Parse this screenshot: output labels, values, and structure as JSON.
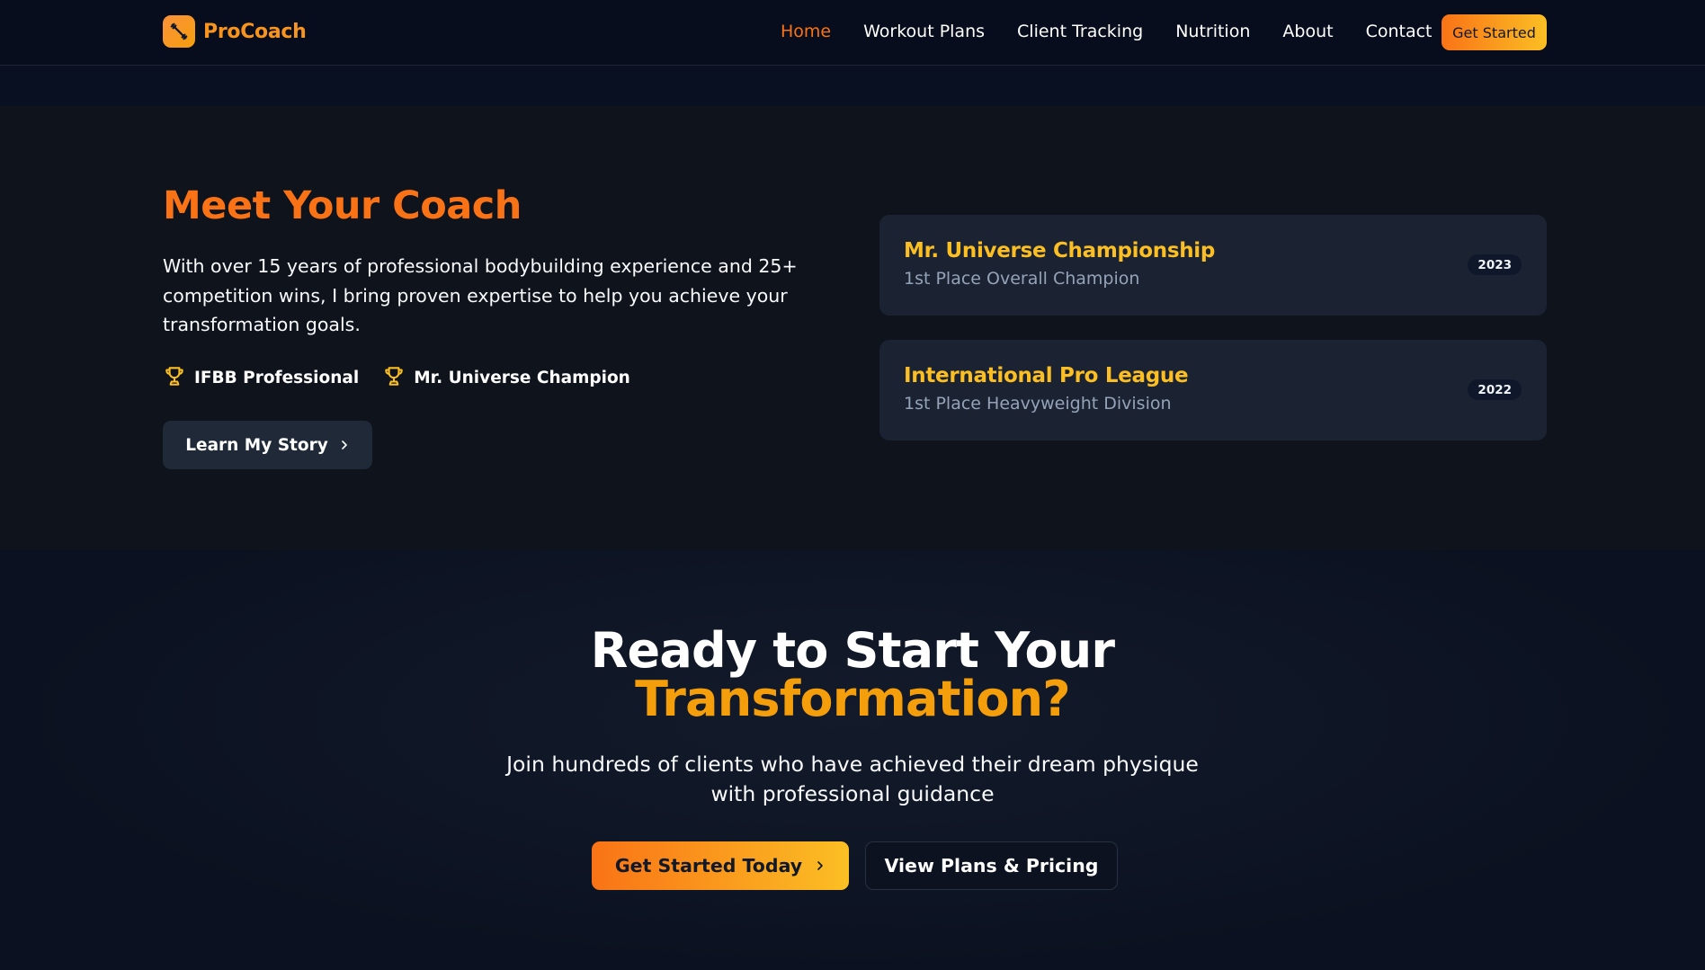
{
  "nav": {
    "brand": "ProCoach",
    "links": [
      {
        "label": "Home",
        "active": true
      },
      {
        "label": "Workout Plans",
        "active": false
      },
      {
        "label": "Client Tracking",
        "active": false
      },
      {
        "label": "Nutrition",
        "active": false
      },
      {
        "label": "About",
        "active": false
      },
      {
        "label": "Contact",
        "active": false
      }
    ],
    "cta_label": "Get Started"
  },
  "coach": {
    "title": "Meet Your Coach",
    "description": "With over 15 years of professional bodybuilding experience and 25+ competition wins, I bring proven expertise to help you achieve your transformation goals.",
    "badges": [
      {
        "icon": "trophy-icon",
        "label": "IFBB Professional"
      },
      {
        "icon": "trophy-icon",
        "label": "Mr. Universe Champion"
      }
    ],
    "button_label": "Learn My Story",
    "achievements": [
      {
        "title": "Mr. Universe Championship",
        "subtitle": "1st Place Overall Champion",
        "year": "2023"
      },
      {
        "title": "International Pro League",
        "subtitle": "1st Place Heavyweight Division",
        "year": "2022"
      }
    ]
  },
  "cta": {
    "title_line1": "Ready to Start Your",
    "title_line2": "Transformation?",
    "subtitle": "Join hundreds of clients who have achieved their dream physique with professional guidance",
    "primary_label": "Get Started Today",
    "secondary_label": "View Plans & Pricing"
  },
  "colors": {
    "accent_orange": "#f97316",
    "accent_amber": "#fbbf24",
    "background": "#0b1120",
    "section_bg": "#0f131c",
    "card_bg": "#1b2332"
  }
}
